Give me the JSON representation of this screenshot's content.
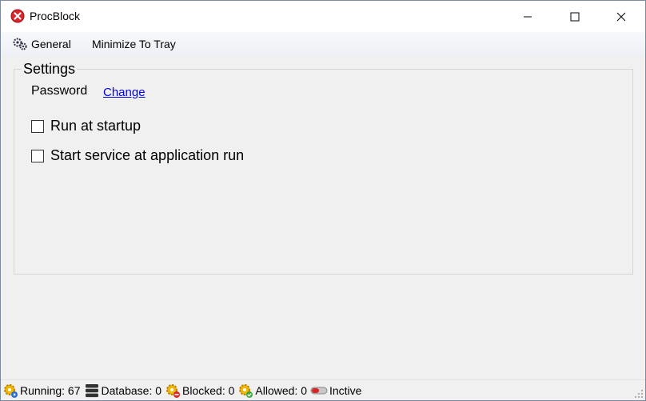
{
  "window": {
    "title": "ProcBlock"
  },
  "menu": {
    "general_label": "General",
    "tray_label": "Minimize To Tray"
  },
  "settings": {
    "legend": "Settings",
    "password_label": "Password",
    "password_link": "Change",
    "run_at_startup": {
      "label": "Run at startup",
      "checked": false
    },
    "start_service": {
      "label": "Start service at application run",
      "checked": false
    }
  },
  "status": {
    "running": "Running: 67",
    "database": "Database: 0",
    "blocked": "Blocked: 0",
    "allowed": "Allowed: 0",
    "service_state": "Inctive"
  },
  "colors": {
    "accent_red": "#d9262b",
    "link_blue": "#0000ee",
    "gear_yellow": "#f2b705"
  }
}
